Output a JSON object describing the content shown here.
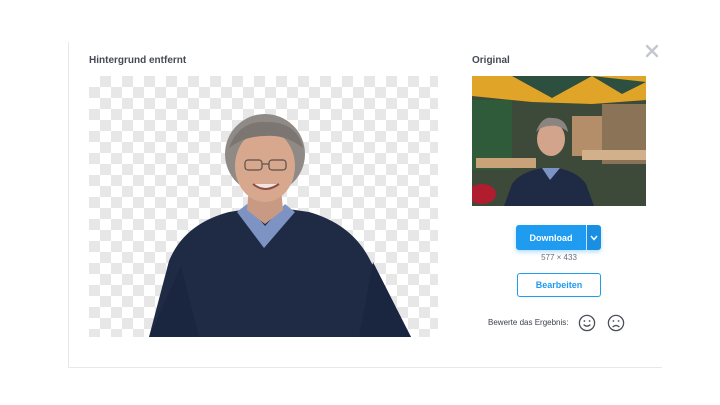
{
  "panel": {
    "result_title": "Hintergrund entfernt",
    "original_title": "Original"
  },
  "icons": {
    "close": "close-icon",
    "dropdown": "chevron-down-icon",
    "rate_good": "smiley-happy-icon",
    "rate_bad": "smiley-sad-icon"
  },
  "actions": {
    "download_label": "Download",
    "dimensions": "577 × 433",
    "edit_label": "Bearbeiten"
  },
  "rating": {
    "label": "Bewerte das Ergebnis:"
  },
  "colors": {
    "accent": "#1f9bf0",
    "checker": "#e7e7e7",
    "sweater": "#1f2b45",
    "shirt": "#7d93c4"
  }
}
